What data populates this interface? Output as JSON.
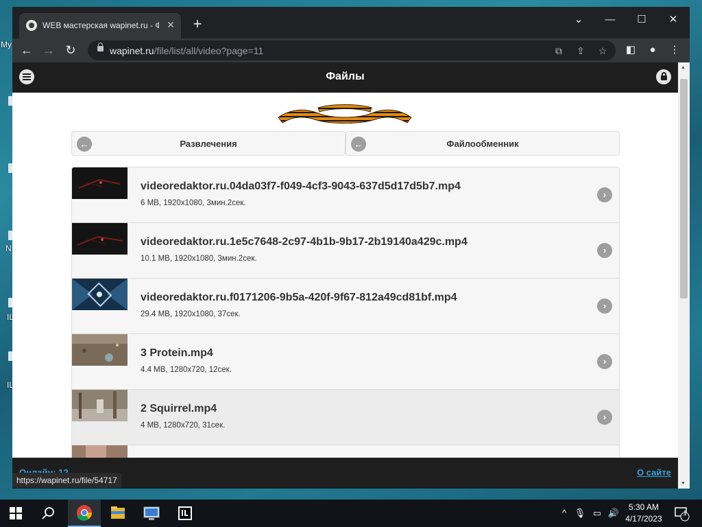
{
  "desktop": {
    "labels": [
      "My",
      "N",
      "IL",
      "IL"
    ]
  },
  "browser": {
    "tab": {
      "title": "WEB мастерская wapinet.ru - Фа",
      "favicon": "eye-favicon-icon"
    },
    "url": {
      "domain": "wapinet.ru",
      "path": "/file/list/all/video?page=11"
    },
    "window_controls": {
      "minimize": "—",
      "maximize": "☐",
      "close": "✕",
      "tab_list": "⌄"
    },
    "toolbar_icons": [
      "back-icon",
      "forward-icon",
      "reload-icon",
      "translate-icon",
      "share-icon",
      "bookmark-star-icon",
      "side-panel-icon",
      "profile-icon",
      "more-icon"
    ]
  },
  "site": {
    "title": "Файлы",
    "breadcrumbs": [
      {
        "label": "Развлечения"
      },
      {
        "label": "Файлообменник"
      }
    ],
    "files": [
      {
        "name": "videoredaktor.ru.04da03f7-f049-4cf3-9043-637d5d17d5b7.mp4",
        "meta": "6 MB, 1920x1080, 3мин.2сек.",
        "thumb": "dark"
      },
      {
        "name": "videoredaktor.ru.1e5c7648-2c97-4b1b-9b17-2b19140a429c.mp4",
        "meta": "10.1 MB, 1920x1080, 3мин.2сек.",
        "thumb": "dark"
      },
      {
        "name": "videoredaktor.ru.f0171206-9b5a-420f-9f67-812a49cd81bf.mp4",
        "meta": "29.4 MB, 1920x1080, 37сек.",
        "thumb": "blue"
      },
      {
        "name": "3 Protein.mp4",
        "meta": "4.4 MB, 1280x720, 12сек.",
        "thumb": "ground"
      },
      {
        "name": "2 Squirrel.mp4",
        "meta": "4 MB, 1280x720, 31сек.",
        "thumb": "forest"
      }
    ],
    "footer": {
      "online": "Онлайн: 12",
      "about": "О сайте"
    },
    "status_url": "https://wapinet.ru/file/54717"
  },
  "taskbar": {
    "apps": [
      "chrome-icon",
      "file-explorer-icon",
      "remote-desktop-icon",
      "intellij-icon"
    ],
    "clock": {
      "time": "5:30 AM",
      "date": "4/17/2023"
    },
    "notification_count": "1"
  },
  "colors": {
    "header_bg": "#1e1e1e",
    "link": "#38a0d8",
    "row_bg": "#f6f6f6",
    "row_hover_bg": "#ececec"
  }
}
